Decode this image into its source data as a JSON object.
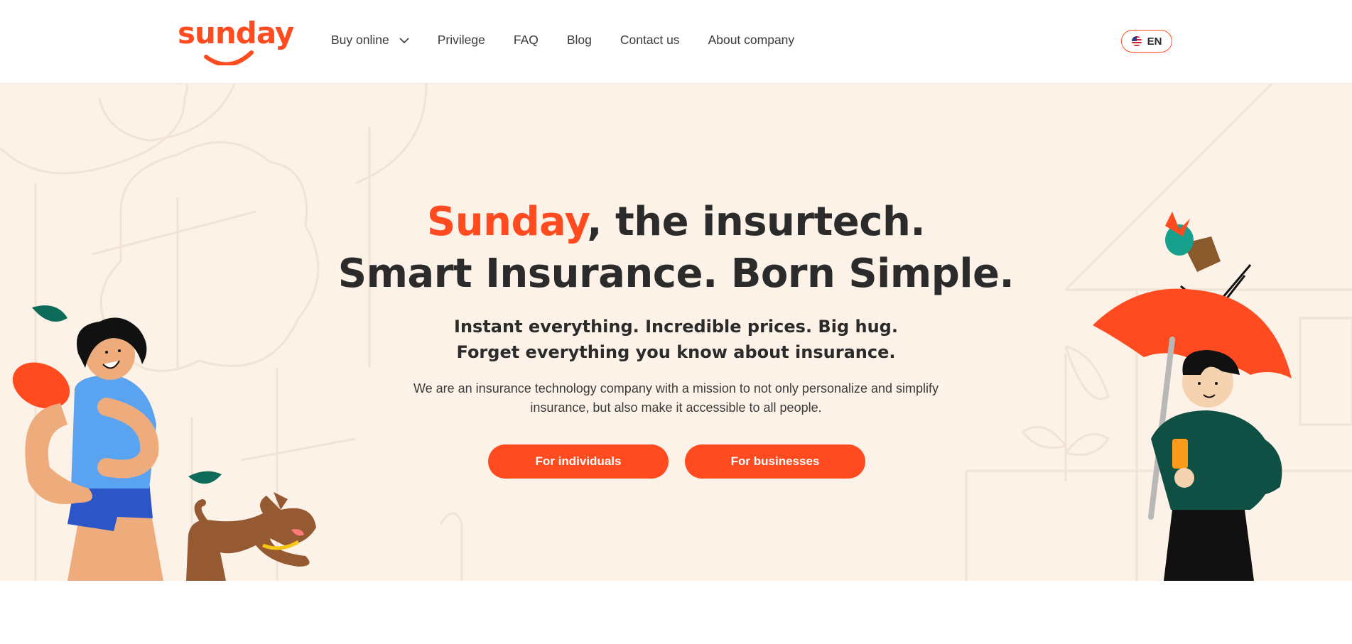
{
  "header": {
    "logo_text": "sunday",
    "nav": [
      {
        "label": "Buy online",
        "has_dropdown": true
      },
      {
        "label": "Privilege"
      },
      {
        "label": "FAQ"
      },
      {
        "label": "Blog"
      },
      {
        "label": "Contact us"
      },
      {
        "label": "About company"
      }
    ],
    "language": {
      "code": "EN",
      "flag_icon": "us-flag-icon"
    }
  },
  "hero": {
    "headline_brand": "Sunday",
    "headline_rest": ", the insurtech.",
    "headline_line2": "Smart Insurance. Born Simple.",
    "subheadline_1": "Instant everything. Incredible prices. Big hug.",
    "subheadline_2": "Forget everything you know about insurance.",
    "description": "We are an insurance technology company with a mission to not only personalize and simplify insurance, but also make it accessible to all people.",
    "cta_individuals": "For individuals",
    "cta_businesses": "For businesses"
  },
  "colors": {
    "brand": "#ff4b1f",
    "hero_background": "#fdf2e8",
    "text": "#2b2b2b"
  }
}
